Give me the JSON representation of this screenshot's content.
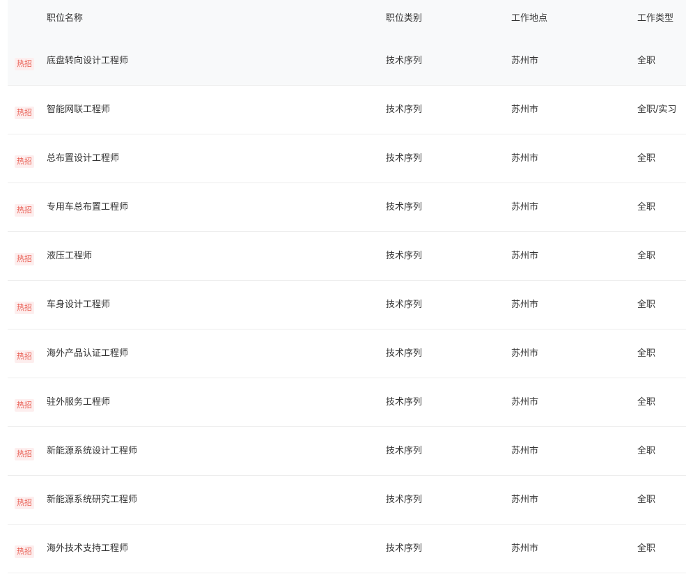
{
  "header": {
    "name": "职位名称",
    "category": "职位类别",
    "location": "工作地点",
    "type": "工作类型"
  },
  "colors": {
    "badge_text": "#e85a4f",
    "badge_bg": "#fdeeee",
    "header_bg": "#f8f9fa",
    "divider": "#ededed"
  },
  "jobs": [
    {
      "badge": "热招",
      "name": "底盘转向设计工程师",
      "category": "技术序列",
      "location": "苏州市",
      "type": "全职"
    },
    {
      "badge": "热招",
      "name": "智能网联工程师",
      "category": "技术序列",
      "location": "苏州市",
      "type": "全职/实习"
    },
    {
      "badge": "热招",
      "name": "总布置设计工程师",
      "category": "技术序列",
      "location": "苏州市",
      "type": "全职"
    },
    {
      "badge": "热招",
      "name": "专用车总布置工程师",
      "category": "技术序列",
      "location": "苏州市",
      "type": "全职"
    },
    {
      "badge": "热招",
      "name": "液压工程师",
      "category": "技术序列",
      "location": "苏州市",
      "type": "全职"
    },
    {
      "badge": "热招",
      "name": "车身设计工程师",
      "category": "技术序列",
      "location": "苏州市",
      "type": "全职"
    },
    {
      "badge": "热招",
      "name": "海外产品认证工程师",
      "category": "技术序列",
      "location": "苏州市",
      "type": "全职"
    },
    {
      "badge": "热招",
      "name": "驻外服务工程师",
      "category": "技术序列",
      "location": "苏州市",
      "type": "全职"
    },
    {
      "badge": "热招",
      "name": "新能源系统设计工程师",
      "category": "技术序列",
      "location": "苏州市",
      "type": "全职"
    },
    {
      "badge": "热招",
      "name": "新能源系统研究工程师",
      "category": "技术序列",
      "location": "苏州市",
      "type": "全职"
    },
    {
      "badge": "热招",
      "name": "海外技术支持工程师",
      "category": "技术序列",
      "location": "苏州市",
      "type": "全职"
    }
  ]
}
